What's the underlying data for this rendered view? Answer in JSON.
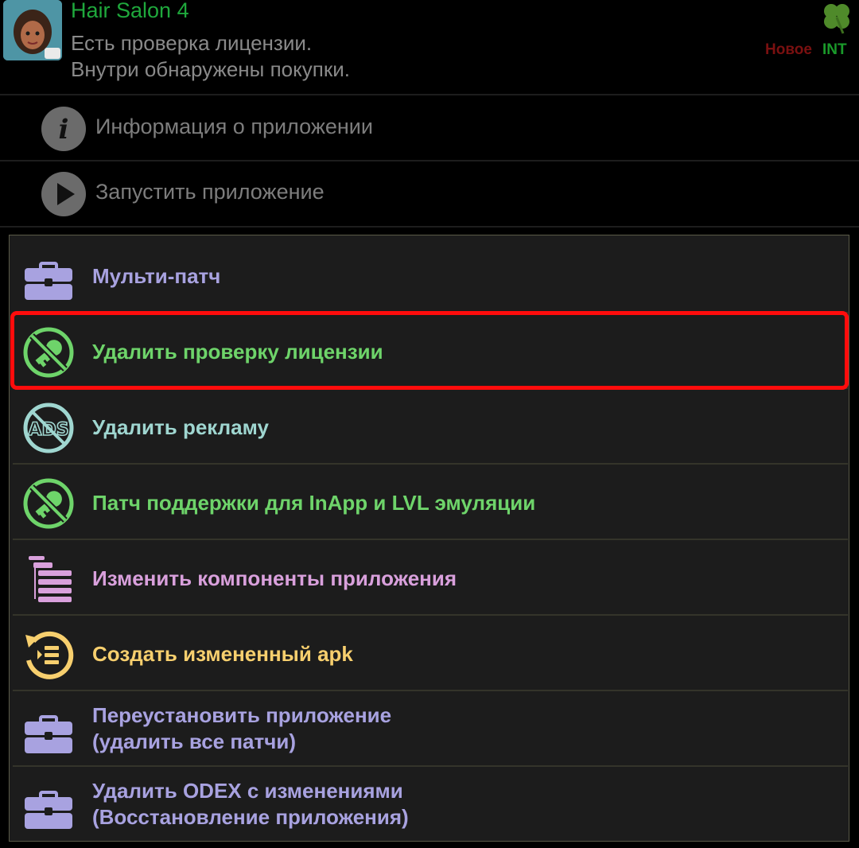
{
  "app": {
    "title": "Hair Salon 4",
    "desc_line1": "Есть проверка лицензии.",
    "desc_line2": "Внутри обнаружены покупки.",
    "badge_new": "Новое",
    "badge_int": "INT"
  },
  "background_actions": [
    {
      "label": "Информация о приложении",
      "icon": "info-icon"
    },
    {
      "label": "Запустить приложение",
      "icon": "play-icon"
    }
  ],
  "menu": {
    "items": [
      {
        "line1": "Мульти-патч",
        "line2": "",
        "icon": "toolbox-icon",
        "color": "#a8a2e0"
      },
      {
        "line1": "Удалить проверку лицензии",
        "line2": "",
        "icon": "no-license-key-icon",
        "color": "#6ed46a",
        "highlighted": true
      },
      {
        "line1": "Удалить рекламу",
        "line2": "",
        "icon": "no-ads-icon",
        "color": "#9fd6d0"
      },
      {
        "line1": "Патч поддержки для InApp и LVL эмуляции",
        "line2": "",
        "icon": "no-license-key-icon",
        "color": "#6ed46a"
      },
      {
        "line1": "Изменить компоненты приложения",
        "line2": "",
        "icon": "components-list-icon",
        "color": "#d9a0dc"
      },
      {
        "line1": "Создать измененный apk",
        "line2": "",
        "icon": "rebuild-apk-icon",
        "color": "#f7cf6e"
      },
      {
        "line1": "Переустановить приложение",
        "line2": "(удалить все патчи)",
        "icon": "toolbox-icon",
        "color": "#a8a2e0"
      },
      {
        "line1": "Удалить ODEX с изменениями",
        "line2": "(Восстановление приложения)",
        "icon": "toolbox-icon",
        "color": "#a8a2e0"
      }
    ]
  },
  "colors": {
    "highlight": "#ff0c0c",
    "dialog_bg": "#1c1c1c",
    "app_title": "#1fa83c"
  }
}
